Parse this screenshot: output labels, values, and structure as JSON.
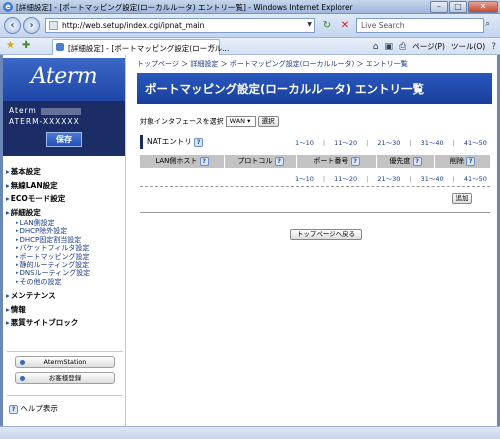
{
  "window": {
    "title": "[詳細設定] - [ポートマッピング設定(ローカルルータ) エントリ一覧] - Windows Internet Explorer"
  },
  "browser": {
    "url": "http://web.setup/index.cgi/ipnat_main",
    "search_placeholder": "Live Search",
    "tab_label": "[詳細設定] - [ポートマッピング設定(ローカル...",
    "page_menu": "ページ(P)",
    "tools_menu": "ツール(O)"
  },
  "sidebar": {
    "logo": "Aterm",
    "model_prefix": "Aterm",
    "model_name": "ATERM-XXXXXX",
    "save_label": "保存",
    "groups": [
      {
        "label": "基本設定"
      },
      {
        "label": "無線LAN設定"
      },
      {
        "label": "ECOモード設定"
      },
      {
        "label": "詳細設定"
      }
    ],
    "detail_items": [
      "LAN側設定",
      "DHCP除外設定",
      "DHCP固定割当設定",
      "パケットフィルタ設定",
      "ポートマッピング設定",
      "静的ルーティング設定",
      "DNSルーティング設定",
      "その他の設定"
    ],
    "groups_after": [
      {
        "label": "メンテナンス"
      },
      {
        "label": "情報"
      },
      {
        "label": "悪質サイトブロック"
      }
    ],
    "station_button": "AtermStation",
    "register_button": "お客様登録",
    "help_label": "ヘルプ表示"
  },
  "main": {
    "breadcrumb": [
      "トップページ",
      "詳細設定",
      "ポートマッピング設定(ローカルルータ)",
      "エントリ一覧"
    ],
    "page_title": "ポートマッピング設定(ローカルルータ) エントリ一覧",
    "interface_label": "対象インタフェースを選択",
    "interface_value": "WAN",
    "select_button": "選択",
    "nat_label": "NATエントリ",
    "pages": [
      "1～10",
      "11～20",
      "21～30",
      "31～40",
      "41～50"
    ],
    "columns": [
      "LAN側ホスト",
      "プロトコル",
      "ポート番号",
      "優先度",
      "削除"
    ],
    "add_button": "追加",
    "top_button": "トップページへ戻る"
  }
}
